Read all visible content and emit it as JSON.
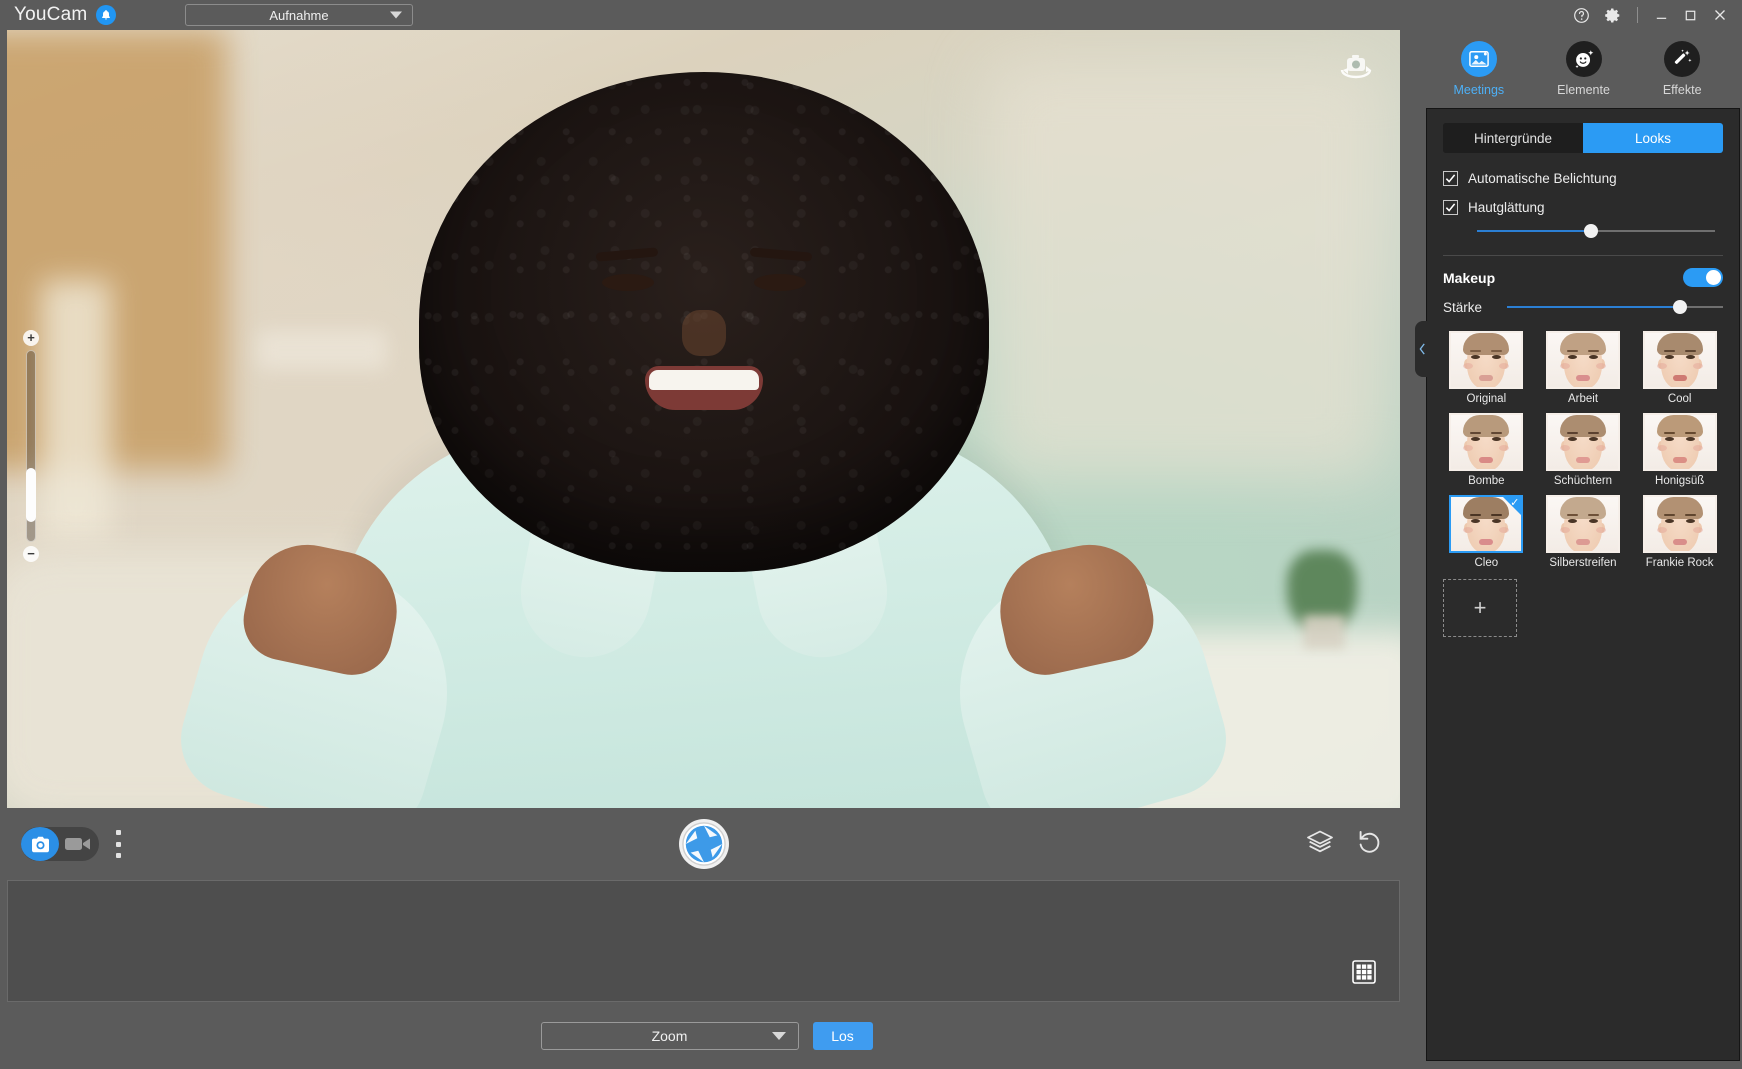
{
  "app": {
    "brand": "YouCam",
    "bell_icon": "notification-bell-icon",
    "mode_dropdown": {
      "value": "Aufnahme",
      "caret_icon": "chevron-down-icon"
    }
  },
  "window_controls": {
    "help_icon": "help-circle-icon",
    "settings_icon": "gear-icon",
    "minimize_icon": "minimize-icon",
    "maximize_icon": "maximize-icon",
    "close_icon": "close-icon"
  },
  "preview": {
    "switch_camera_icon": "switch-camera-icon",
    "zoom_slider": {
      "plus_label": "+",
      "minus_label": "−",
      "value_percent": 14
    }
  },
  "capture_toolbar": {
    "photo_mode_icon": "camera-icon",
    "video_mode_icon": "video-camera-icon",
    "more_options_icon": "kebab-menu-icon",
    "shutter_icon": "shutter-aperture-icon",
    "layers_icon": "layers-icon",
    "reset_icon": "reset-undo-icon"
  },
  "gallery": {
    "grid_view_icon": "grid-view-icon"
  },
  "bottom_bar": {
    "zoom_dropdown": {
      "value": "Zoom",
      "caret_icon": "chevron-down-icon"
    },
    "go_button": "Los"
  },
  "right_panel": {
    "nav_tabs": [
      {
        "label": "Meetings",
        "icon": "meetings-photo-icon",
        "active": true
      },
      {
        "label": "Elemente",
        "icon": "smiley-sparkle-icon",
        "active": false
      },
      {
        "label": "Effekte",
        "icon": "magic-wand-icon",
        "active": false
      }
    ],
    "segmented": [
      {
        "label": "Hintergründe",
        "active": false
      },
      {
        "label": "Looks",
        "active": true
      }
    ],
    "checkboxes": [
      {
        "label": "Automatische Belichtung",
        "checked": true
      },
      {
        "label": "Hautglättung",
        "checked": true
      }
    ],
    "smoothing_slider": {
      "value_percent": 48
    },
    "makeup": {
      "title": "Makeup",
      "enabled": true,
      "strength_label": "Stärke",
      "strength_percent": 80
    },
    "looks": [
      {
        "label": "Original",
        "selected": false,
        "hair": "#b08f72",
        "lip": "#d9a095",
        "brow": "#7a5b42"
      },
      {
        "label": "Arbeit",
        "selected": false,
        "hair": "#c0a184",
        "lip": "#d98f8e",
        "brow": "#6b4e37"
      },
      {
        "label": "Cool",
        "selected": false,
        "hair": "#a88a6e",
        "lip": "#cf7a72",
        "brow": "#5d4431"
      },
      {
        "label": "Bombe",
        "selected": false,
        "hair": "#b89a7c",
        "lip": "#d98a86",
        "brow": "#614734"
      },
      {
        "label": "Schüchtern",
        "selected": false,
        "hair": "#ac8d70",
        "lip": "#e09a93",
        "brow": "#5b4130"
      },
      {
        "label": "Honigsüß",
        "selected": false,
        "hair": "#bb9a79",
        "lip": "#db8f85",
        "brow": "#66492f"
      },
      {
        "label": "Cleo",
        "selected": true,
        "hair": "#9d7e62",
        "lip": "#d98c8c",
        "brow": "#4b3524"
      },
      {
        "label": "Silberstreifen",
        "selected": false,
        "hair": "#c3a98e",
        "lip": "#dd9b94",
        "brow": "#6e5139"
      },
      {
        "label": "Frankie Rock",
        "selected": false,
        "hair": "#b29173",
        "lip": "#d98e8a",
        "brow": "#5f452f"
      }
    ],
    "add_look": {
      "label": "+"
    },
    "collapse_icon": "chevron-left-icon"
  },
  "colors": {
    "accent": "#2b9bf4",
    "panel_bg": "#2b2b2b",
    "window_bg": "#5b5b5b"
  }
}
